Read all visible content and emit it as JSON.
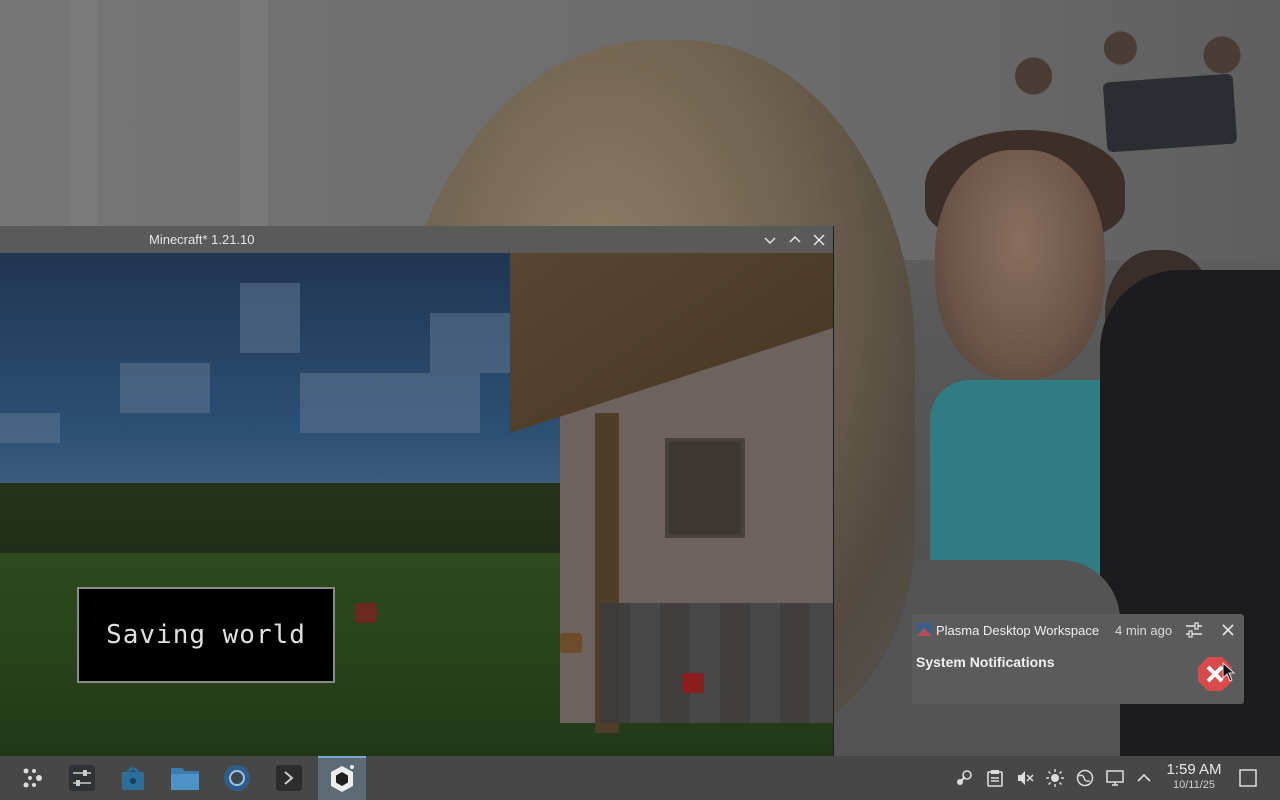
{
  "window": {
    "title": "Minecraft* 1.21.10",
    "overlay_text": "Saving world"
  },
  "notification": {
    "app_name": "Plasma Desktop Workspace",
    "time": "4 min ago",
    "summary": "System Notifications",
    "icon": "error-icon"
  },
  "taskbar": {
    "launchers": [
      "application-launcher-icon",
      "system-settings-icon",
      "discover-store-icon",
      "file-manager-icon",
      "browser-icon",
      "terminal-icon",
      "minecraft-icon"
    ],
    "tray_icons": [
      "steam-icon",
      "clipboard-icon",
      "volume-muted-icon",
      "brightness-icon",
      "network-icon",
      "display-icon",
      "tray-expand-icon"
    ],
    "clock": {
      "time": "1:59 AM",
      "date": "10/11/25"
    }
  },
  "colors": {
    "accent": "#7aa7d6",
    "error": "#d94b4b"
  }
}
